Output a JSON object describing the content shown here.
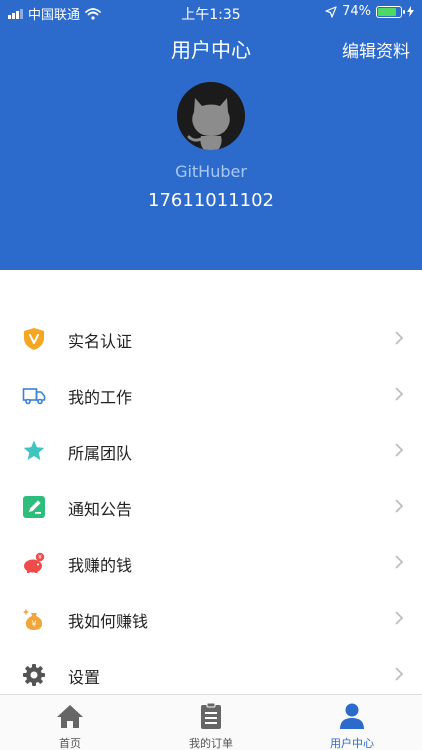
{
  "status_bar": {
    "carrier": "中国联通",
    "time": "上午1:35",
    "battery": "74%",
    "battery_level": 0.74
  },
  "nav": {
    "title": "用户中心",
    "edit_label": "编辑资料"
  },
  "profile": {
    "username": "GitHuber",
    "phone": "17611011102"
  },
  "menu": {
    "items": [
      {
        "label": "实名认证",
        "icon": "verified-shield-icon"
      },
      {
        "label": "我的工作",
        "icon": "truck-icon"
      },
      {
        "label": "所属团队",
        "icon": "star-icon"
      },
      {
        "label": "通知公告",
        "icon": "notice-pen-icon"
      },
      {
        "label": "我赚的钱",
        "icon": "piggy-bank-icon"
      },
      {
        "label": "我如何赚钱",
        "icon": "money-bag-icon"
      },
      {
        "label": "设置",
        "icon": "gear-icon"
      }
    ]
  },
  "tabbar": {
    "tabs": [
      {
        "label": "首页",
        "icon": "home-icon",
        "active": false
      },
      {
        "label": "我的订单",
        "icon": "clipboard-icon",
        "active": false
      },
      {
        "label": "用户中心",
        "icon": "user-icon",
        "active": true
      }
    ]
  },
  "colors": {
    "primary": "#2C6BCB",
    "battery": "#4CD964",
    "username": "#A9C8F2"
  }
}
